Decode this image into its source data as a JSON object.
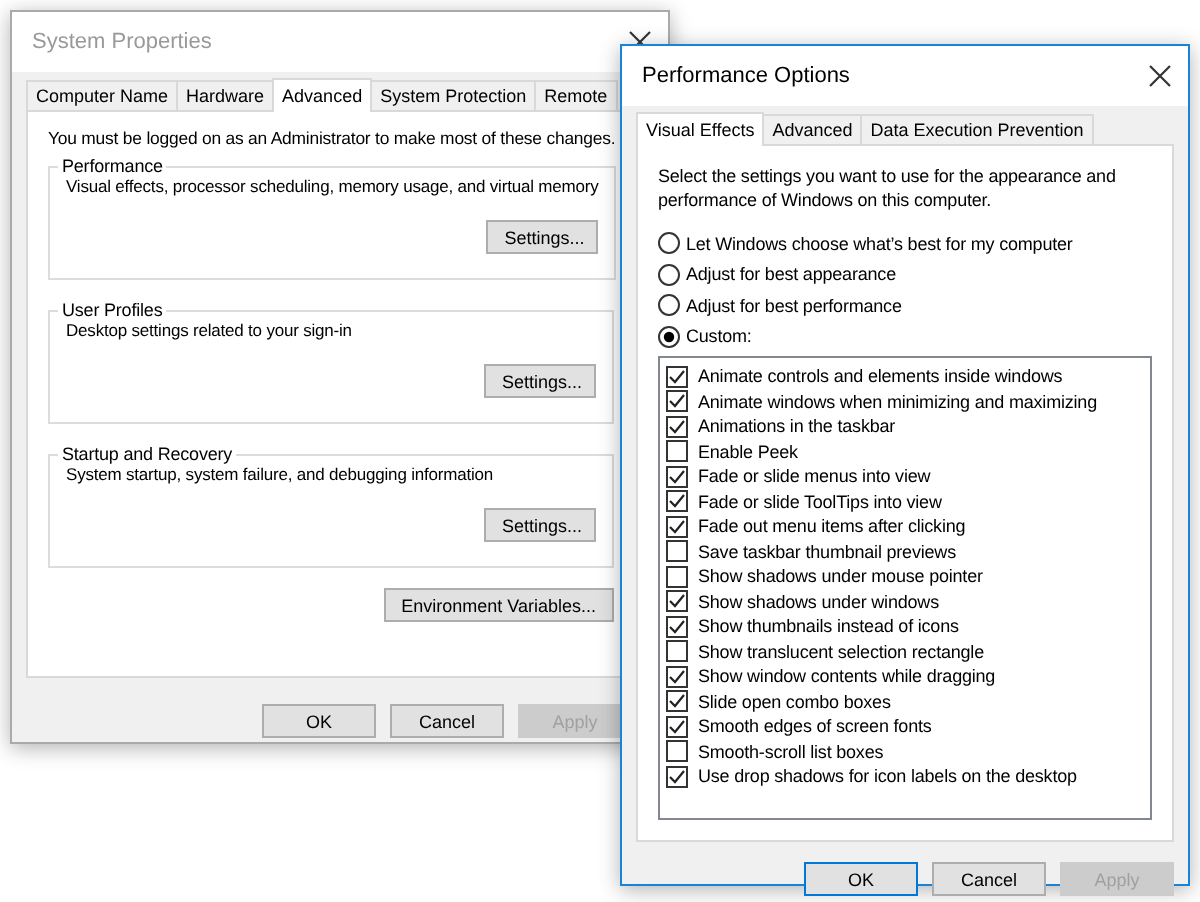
{
  "system_properties": {
    "title": "System Properties",
    "active": false,
    "tabs": [
      {
        "label": "Computer Name",
        "selected": false
      },
      {
        "label": "Hardware",
        "selected": false
      },
      {
        "label": "Advanced",
        "selected": true
      },
      {
        "label": "System Protection",
        "selected": false
      },
      {
        "label": "Remote",
        "selected": false
      }
    ],
    "notice": "You must be logged on as an Administrator to make most of these changes.",
    "groups": [
      {
        "title": "Performance",
        "description": "Visual effects, processor scheduling, memory usage, and virtual memory",
        "button": "Settings..."
      },
      {
        "title": "User Profiles",
        "description": "Desktop settings related to your sign-in",
        "button": "Settings..."
      },
      {
        "title": "Startup and Recovery",
        "description": "System startup, system failure, and debugging information",
        "button": "Settings..."
      }
    ],
    "environment_button": "Environment Variables...",
    "buttons": [
      {
        "label": "OK",
        "disabled": false,
        "default": false
      },
      {
        "label": "Cancel",
        "disabled": false,
        "default": false
      },
      {
        "label": "Apply",
        "disabled": true,
        "default": false
      }
    ]
  },
  "performance_options": {
    "title": "Performance Options",
    "active": true,
    "tabs": [
      {
        "label": "Visual Effects",
        "selected": true
      },
      {
        "label": "Advanced",
        "selected": false
      },
      {
        "label": "Data Execution Prevention",
        "selected": false
      }
    ],
    "description": "Select the settings you want to use for the appearance and performance of Windows on this computer.",
    "options": [
      {
        "label": "Let Windows choose what’s best for my computer",
        "selected": false
      },
      {
        "label": "Adjust for best appearance",
        "selected": false
      },
      {
        "label": "Adjust for best performance",
        "selected": false
      },
      {
        "label": "Custom:",
        "selected": true
      }
    ],
    "effects": [
      {
        "label": "Animate controls and elements inside windows",
        "checked": true
      },
      {
        "label": "Animate windows when minimizing and maximizing",
        "checked": true
      },
      {
        "label": "Animations in the taskbar",
        "checked": true
      },
      {
        "label": "Enable Peek",
        "checked": false
      },
      {
        "label": "Fade or slide menus into view",
        "checked": true
      },
      {
        "label": "Fade or slide ToolTips into view",
        "checked": true
      },
      {
        "label": "Fade out menu items after clicking",
        "checked": true
      },
      {
        "label": "Save taskbar thumbnail previews",
        "checked": false
      },
      {
        "label": "Show shadows under mouse pointer",
        "checked": false
      },
      {
        "label": "Show shadows under windows",
        "checked": true
      },
      {
        "label": "Show thumbnails instead of icons",
        "checked": true
      },
      {
        "label": "Show translucent selection rectangle",
        "checked": false
      },
      {
        "label": "Show window contents while dragging",
        "checked": true
      },
      {
        "label": "Slide open combo boxes",
        "checked": true
      },
      {
        "label": "Smooth edges of screen fonts",
        "checked": true
      },
      {
        "label": "Smooth-scroll list boxes",
        "checked": false
      },
      {
        "label": "Use drop shadows for icon labels on the desktop",
        "checked": true
      }
    ],
    "buttons": [
      {
        "label": "OK",
        "disabled": false,
        "default": true
      },
      {
        "label": "Cancel",
        "disabled": false,
        "default": false
      },
      {
        "label": "Apply",
        "disabled": true,
        "default": false
      }
    ]
  }
}
